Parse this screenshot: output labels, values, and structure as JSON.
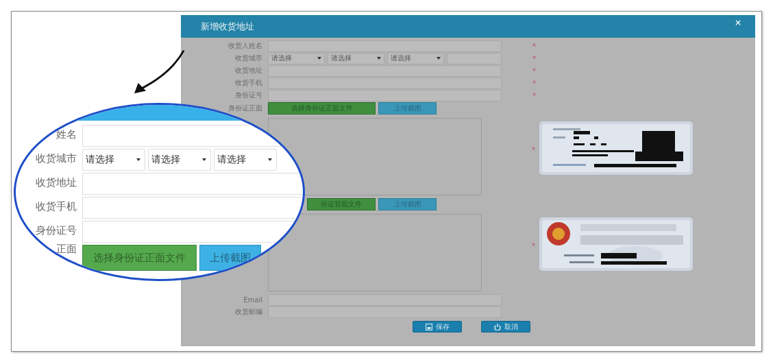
{
  "dialog": {
    "title": "新增收货地址",
    "close": "×",
    "fields": [
      {
        "kind": "text",
        "label": "收货人姓名",
        "required_mark": "*"
      },
      {
        "kind": "selects",
        "label": "收货城市",
        "options": [
          "请选择",
          "请选择",
          "请选择"
        ],
        "required_mark": "*"
      },
      {
        "kind": "text",
        "label": "收货地址",
        "required_mark": "*"
      },
      {
        "kind": "text",
        "label": "收货手机",
        "required_mark": "*"
      },
      {
        "kind": "text",
        "label": "身份证号",
        "required_mark": "*"
      },
      {
        "kind": "upload",
        "label": "身份证正面",
        "buttons": [
          "选择身份证正面文件",
          "上传截图"
        ],
        "required_mark": "*"
      },
      {
        "kind": "upload",
        "buttons": [
          "份证背面文件",
          "上传截图"
        ],
        "required_mark": "*"
      },
      {
        "kind": "text",
        "label": "Email"
      },
      {
        "kind": "text",
        "label": "收货邮编"
      }
    ],
    "buttons": [
      {
        "kind": "save",
        "label": "保存"
      },
      {
        "kind": "cancel",
        "label": "取消"
      }
    ]
  },
  "magnifier": {
    "fields": [
      {
        "kind": "text",
        "label": "姓名"
      },
      {
        "kind": "selects",
        "label": "收货城市",
        "options": [
          "请选择",
          "请选择",
          "请选择"
        ]
      },
      {
        "kind": "text",
        "label": "收货地址"
      },
      {
        "kind": "text",
        "label": "收货手机"
      },
      {
        "kind": "text",
        "label": "身份证号"
      },
      {
        "kind": "upload",
        "label": "正面",
        "buttons": [
          "选择身份证正面文件",
          "上传截图"
        ]
      }
    ]
  }
}
